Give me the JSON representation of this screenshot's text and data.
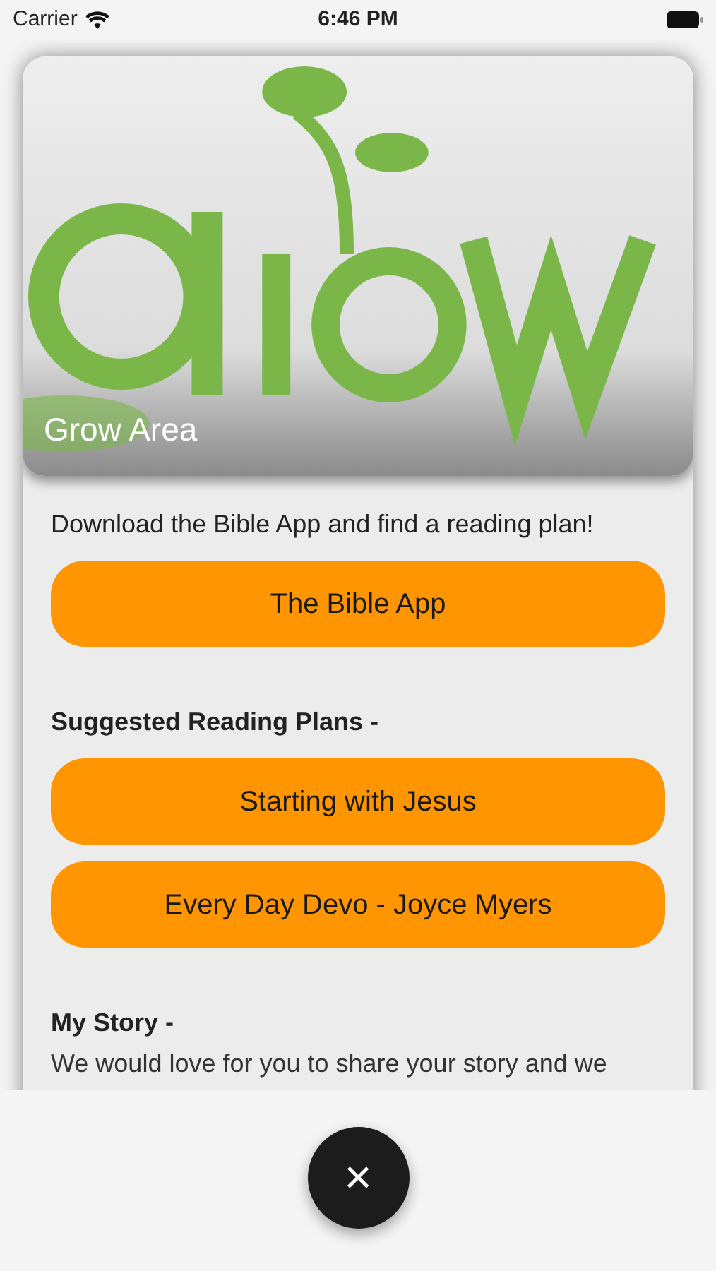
{
  "status_bar": {
    "carrier": "Carrier",
    "time": "6:46 PM"
  },
  "hero": {
    "kind": "picture",
    "title": "Grow Area"
  },
  "intro": "Download the Bible App and find a reading plan!",
  "app_button": "The Bible App",
  "plans_heading": "Suggested Reading Plans -",
  "plan_buttons": [
    "Starting with Jesus",
    "Every Day Devo - Joyce Myers"
  ],
  "story_heading": "My Story -",
  "story_text": "We would love for you to share your story and we",
  "close_button": "×"
}
